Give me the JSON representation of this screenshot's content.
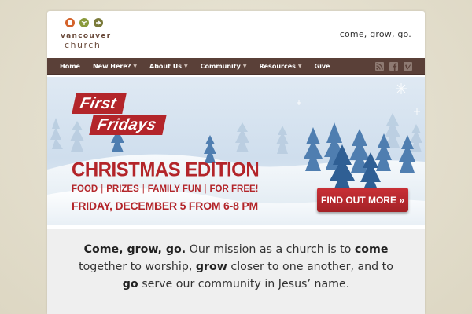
{
  "header": {
    "logo_name": "vancouver",
    "logo_sub": "church",
    "tagline": "come, grow, go."
  },
  "nav": {
    "items": [
      {
        "label": "Home",
        "has_menu": false
      },
      {
        "label": "New Here?",
        "has_menu": true
      },
      {
        "label": "About Us",
        "has_menu": true
      },
      {
        "label": "Community",
        "has_menu": true
      },
      {
        "label": "Resources",
        "has_menu": true
      },
      {
        "label": "Give",
        "has_menu": false
      }
    ],
    "social_icons": [
      "rss-icon",
      "facebook-icon",
      "vimeo-icon"
    ]
  },
  "banner": {
    "title_line1": "First",
    "title_line2": "Fridays",
    "edition": "CHRISTMAS EDITION",
    "tags": [
      "FOOD",
      "PRIZES",
      "FAMILY FUN"
    ],
    "free": "FOR FREE!",
    "date": "FRIDAY, DECEMBER 5 FROM 6-8 PM",
    "cta_label": "FIND OUT MORE »",
    "slides_total": 2,
    "slide_active": 1
  },
  "mission": {
    "lead": "Come, grow, go.",
    "p1": " Our mission as a church is to ",
    "w_come": "come",
    "p2": " together to worship, ",
    "w_grow": "grow",
    "p3": " closer to one another, and to ",
    "w_go": "go",
    "p4": " serve our community in Jesus’ name."
  },
  "colors": {
    "nav_bg": "#5a4038",
    "brand_red": "#b3252a",
    "page_bg": "#e8e3d3"
  }
}
